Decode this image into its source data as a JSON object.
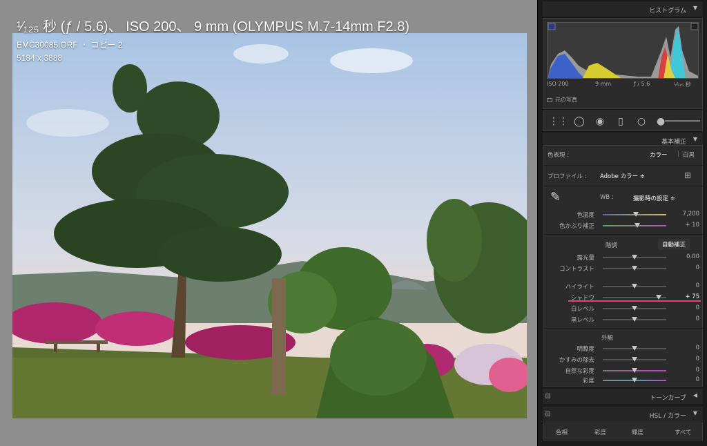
{
  "overlay": {
    "line1": "¹⁄₁₂₅ 秒 (ƒ / 5.6)、 ISO 200、 9 mm (OLYMPUS M.7-14mm F2.8)",
    "line2": "EMC30085.ORF ・ コピー 2",
    "line3": "5184 x 3888"
  },
  "histogram": {
    "title": "ヒストグラム",
    "iso": "ISO 200",
    "focal": "9 mm",
    "aperture": "ƒ / 5.6",
    "shutter": "¹⁄₁₂₅ 秒",
    "original_photo": "元の写真"
  },
  "basic": {
    "title": "基本補正",
    "treatment_label": "色表現 :",
    "treatment_color": "カラー",
    "treatment_bw": "白黒",
    "profile_label": "プロファイル :",
    "profile_value": "Adobe カラー ≑",
    "wb_label": "WB :",
    "wb_value": "撮影時の設定 ≑",
    "tone_label": "階調",
    "auto_label": "自動補正",
    "presence_label": "外観",
    "sliders": {
      "temp": {
        "label": "色温度",
        "value": "7,200",
        "pos": 0.52
      },
      "tint": {
        "label": "色かぶり補正",
        "value": "+ 10",
        "pos": 0.54
      },
      "exposure": {
        "label": "露光量",
        "value": "0.00",
        "pos": 0.5
      },
      "contrast": {
        "label": "コントラスト",
        "value": "0",
        "pos": 0.5
      },
      "highlights": {
        "label": "ハイライト",
        "value": "0",
        "pos": 0.5
      },
      "shadows": {
        "label": "シャドウ",
        "value": "+ 75",
        "pos": 0.875
      },
      "whites": {
        "label": "白レベル",
        "value": "0",
        "pos": 0.5
      },
      "blacks": {
        "label": "黒レベル",
        "value": "0",
        "pos": 0.5
      },
      "clarity": {
        "label": "明瞭度",
        "value": "0",
        "pos": 0.5
      },
      "dehaze": {
        "label": "かすみの除去",
        "value": "0",
        "pos": 0.5
      },
      "vibrance": {
        "label": "自然な彩度",
        "value": "0",
        "pos": 0.5
      },
      "saturation": {
        "label": "彩度",
        "value": "0",
        "pos": 0.5
      }
    }
  },
  "tone_curve": {
    "title": "トーンカーブ"
  },
  "hsl": {
    "title": "HSL / カラー",
    "tabs": [
      "色相",
      "彩度",
      "輝度",
      "すべて"
    ]
  },
  "colors": {
    "highlight_line": "#e8407a"
  }
}
